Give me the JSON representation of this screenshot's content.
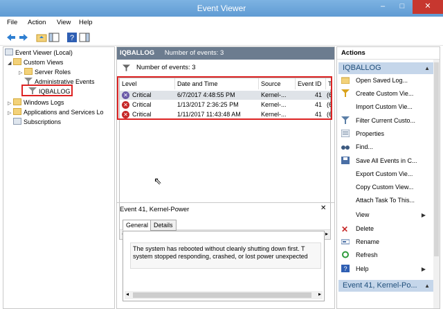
{
  "window": {
    "title": "Event Viewer",
    "minimize": "–",
    "maximize": "□",
    "close": "✕"
  },
  "menu": [
    "File",
    "Action",
    "View",
    "Help"
  ],
  "tree": {
    "root": "Event Viewer (Local)",
    "custom_views": "Custom Views",
    "server_roles": "Server Roles",
    "admin_events": "Administrative Events",
    "iqballog": "IQBALLOG",
    "windows_logs": "Windows Logs",
    "apps_services": "Applications and Services Lo",
    "subscriptions": "Subscriptions"
  },
  "middle": {
    "header_name": "IQBALLOG",
    "header_count": "Number of events: 3",
    "filter_text": "Number of events: 3",
    "columns": [
      "Level",
      "Date and Time",
      "Source",
      "Event ID",
      "T"
    ],
    "rows": [
      {
        "level": "Critical",
        "datetime": "6/7/2017 4:48:55 PM",
        "source": "Kernel-...",
        "event_id": "41",
        "task": "(6"
      },
      {
        "level": "Critical",
        "datetime": "1/13/2017 2:36:25 PM",
        "source": "Kernel-...",
        "event_id": "41",
        "task": "(6"
      },
      {
        "level": "Critical",
        "datetime": "1/11/2017 11:43:48 AM",
        "source": "Kernel-...",
        "event_id": "41",
        "task": "(6"
      }
    ]
  },
  "detail": {
    "title": "Event 41, Kernel-Power",
    "close": "✕",
    "tabs": [
      "General",
      "Details"
    ],
    "text_line1": "The system has rebooted without cleanly shutting down first. T",
    "text_line2": "system stopped responding, crashed, or lost power unexpected"
  },
  "actions": {
    "header": "Actions",
    "section1": "IQBALLOG",
    "items": [
      "Open Saved Log...",
      "Create Custom Vie...",
      "Import Custom Vie...",
      "Filter Current Custo...",
      "Properties",
      "Find...",
      "Save All Events in C...",
      "Export Custom Vie...",
      "Copy Custom View...",
      "Attach Task To This...",
      "View",
      "Delete",
      "Rename",
      "Refresh",
      "Help"
    ],
    "section2": "Event 41, Kernel-Po..."
  },
  "colors": {
    "titlebar": "#5f9bd3",
    "header": "#6c7c8f",
    "highlight": "#dd2222",
    "section": "#c5d6ea"
  }
}
